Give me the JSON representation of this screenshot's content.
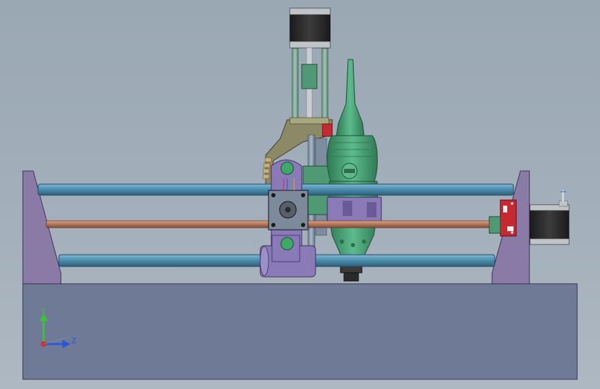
{
  "viewport": {
    "background_top": "#9aa8b4",
    "background_bottom": "#aeb8c2"
  },
  "colors": {
    "base_plate": "#6f7a96",
    "end_plate": "#8a7aa6",
    "rail": "#4d8fb0",
    "lead_screw": "#b3765a",
    "motor_body": "#2b2b2b",
    "printed_part_green": "#4f9a74",
    "mount_olive": "#8c8a66",
    "spindle_green": "#3f9a6e",
    "clamp_purple": "#8a7ab8",
    "endstop_red": "#c8282f",
    "collet_dark": "#3a3a3a"
  },
  "triad": {
    "y_label": "Y",
    "z_label": "Z",
    "y_color": "#3fbf3f",
    "z_color": "#2f56d8",
    "x_color": "#d23030"
  },
  "icons": {
    "view_triad": "axis-triad-icon",
    "model": "cnc-gantry-model"
  }
}
